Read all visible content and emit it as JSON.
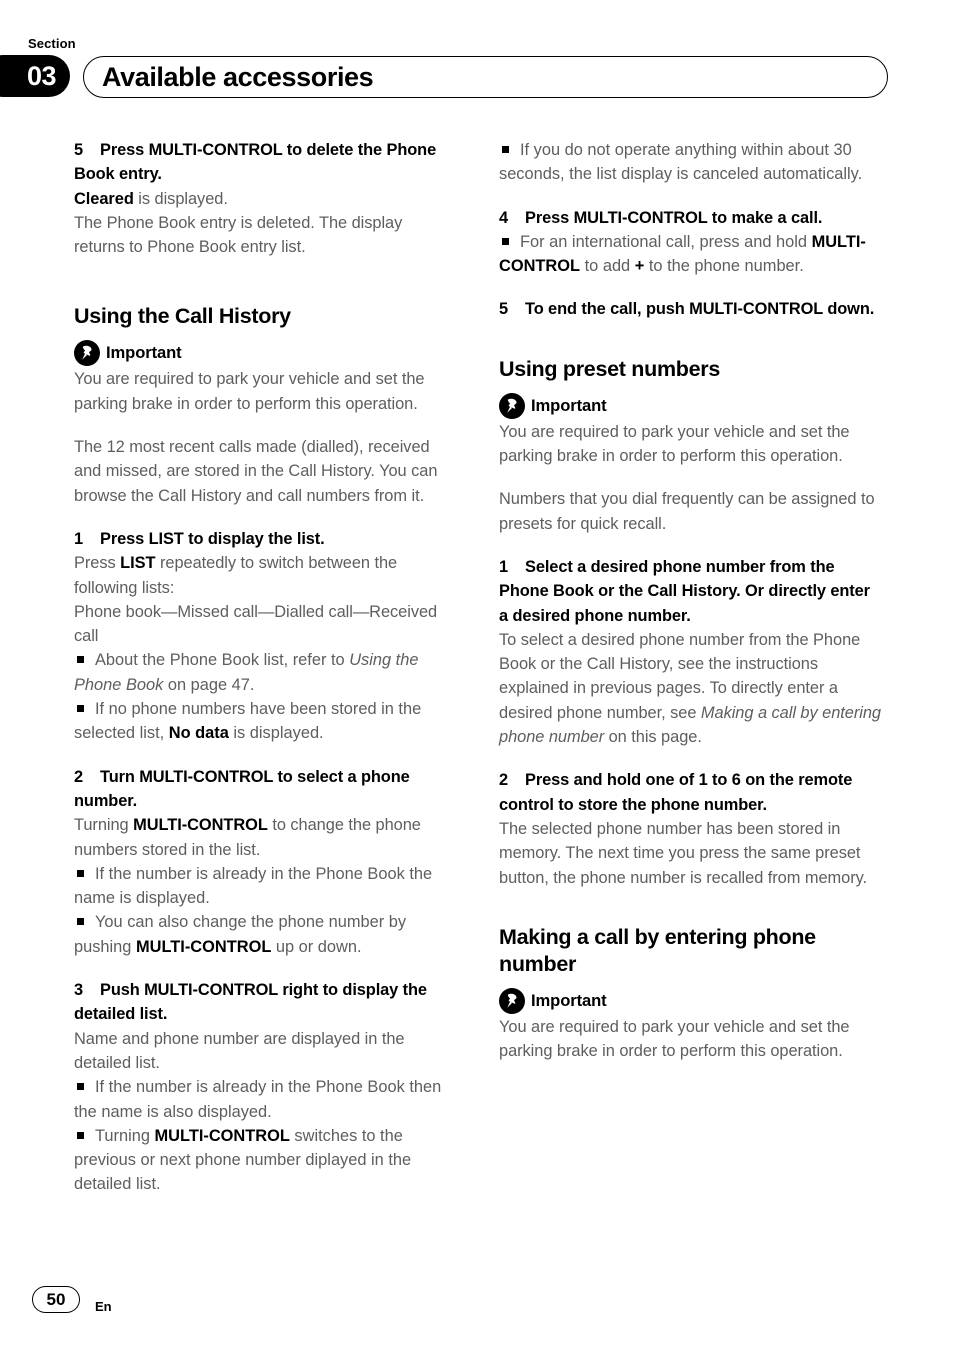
{
  "header": {
    "section_label": "Section",
    "section_number": "03",
    "title": "Available accessories"
  },
  "footer": {
    "page_number": "50",
    "language_code": "En"
  },
  "labels": {
    "important": "Important",
    "important_icon": "pushpin-icon"
  },
  "left_column": {
    "step5_delete": {
      "num": "5",
      "heading": "Press MULTI-CONTROL to delete the Phone Book entry.",
      "body_bold": "Cleared",
      "body_rest": " is displayed.",
      "body2": "The Phone Book entry is deleted. The display returns to Phone Book entry list."
    },
    "heading_call_history": "Using the Call History",
    "important_text": "You are required to park your vehicle and set the parking brake in order to perform this operation.",
    "intro": "The 12 most recent calls made (dialled), received and missed, are stored in the Call History. You can browse the Call History and call numbers from it.",
    "step1": {
      "num": "1",
      "heading": "Press LIST to display the list.",
      "body_pre": "Press ",
      "body_bold": "LIST",
      "body_post": " repeatedly to switch between the following lists:",
      "body2": "Phone book—Missed call—Dialled call—Received call",
      "bullet1_pre": "About the Phone Book list, refer to ",
      "bullet1_italic": "Using the Phone Book",
      "bullet1_post": " on page 47.",
      "bullet2_pre": "If no phone numbers have been stored in the selected list, ",
      "bullet2_bold": "No data",
      "bullet2_post": " is displayed."
    },
    "step2": {
      "num": "2",
      "heading": "Turn MULTI-CONTROL to select a phone number.",
      "body_pre": "Turning ",
      "body_bold": "MULTI-CONTROL",
      "body_post": " to change the phone numbers stored in the list.",
      "bullet1": "If the number is already in the Phone Book the name is displayed.",
      "bullet2_pre": "You can also change the phone number by pushing ",
      "bullet2_bold": "MULTI-CONTROL",
      "bullet2_post": " up or down."
    },
    "step3": {
      "num": "3",
      "heading": "Push MULTI-CONTROL right to display the detailed list.",
      "body": "Name and phone number are displayed in the detailed list.",
      "bullet1": "If the number is already in the Phone Book then the name is also displayed.",
      "bullet2_pre": "Turning ",
      "bullet2_bold": "MULTI-CONTROL",
      "bullet2_post": " switches to the previous or next phone number diplayed in the detailed list."
    }
  },
  "right_column": {
    "bullet_timeout": "If you do not operate anything within about 30 seconds, the list display is canceled automatically.",
    "step4": {
      "num": "4",
      "heading": "Press MULTI-CONTROL to make a call.",
      "bullet_pre": "For an international call, press and hold ",
      "bullet_bold": "MULTI-CONTROL",
      "bullet_mid": " to add ",
      "bullet_plus": "+",
      "bullet_post": " to the phone number."
    },
    "step5": {
      "num": "5",
      "heading": "To end the call, push MULTI-CONTROL down."
    },
    "heading_preset": "Using preset numbers",
    "important_text_preset": "You are required to park your vehicle and set the parking brake in order to perform this operation.",
    "preset_intro": "Numbers that you dial frequently can be assigned to presets for quick recall.",
    "preset_step1": {
      "num": "1",
      "heading": "Select a desired phone number from the Phone Book or the Call History. Or directly enter a desired phone number.",
      "body_pre": "To select a desired phone number from the Phone Book or the Call History, see the instructions explained in previous pages. To directly enter a desired phone number, see ",
      "body_italic": "Making a call by entering phone number",
      "body_post": " on this page."
    },
    "preset_step2": {
      "num": "2",
      "heading": "Press and hold one of 1 to 6 on the remote control to store the phone number.",
      "body": "The selected phone number has been stored in memory. The next time you press the same preset button, the phone number is recalled from memory."
    },
    "heading_making_call": "Making a call by entering phone number",
    "important_text_making_call": "You are required to park your vehicle and set the parking brake in order to perform this operation."
  }
}
